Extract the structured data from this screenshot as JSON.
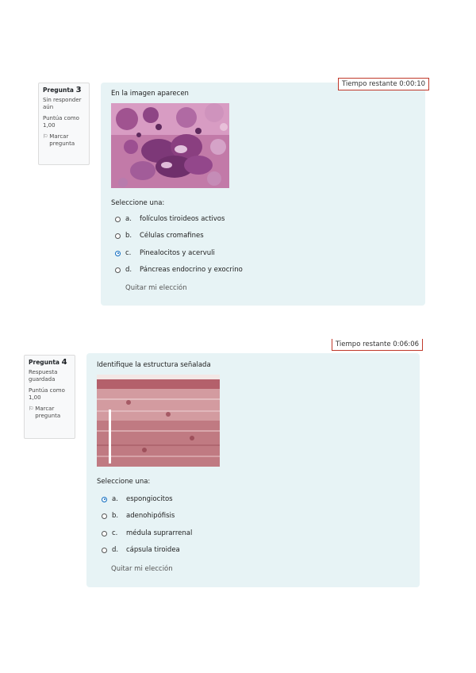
{
  "questions": [
    {
      "label": "Pregunta",
      "number": "3",
      "status": "Sin responder aún",
      "score": "Puntúa como 1,00",
      "flag_label": "Marcar pregunta",
      "timer": "Tiempo restante 0:00:10",
      "text": "En la imagen aparecen",
      "prompt": "Seleccione una:",
      "options": [
        {
          "letter": "a.",
          "text": "folículos tiroideos activos",
          "selected": false
        },
        {
          "letter": "b.",
          "text": "Células cromafines",
          "selected": false
        },
        {
          "letter": "c.",
          "text": "Pinealocitos y acervuli",
          "selected": true
        },
        {
          "letter": "d.",
          "text": "Páncreas endocrino y exocrino",
          "selected": false
        }
      ],
      "clear_label": "Quitar mi elección"
    },
    {
      "label": "Pregunta",
      "number": "4",
      "status": "Respuesta guardada",
      "score": "Puntúa como 1,00",
      "flag_label": "Marcar pregunta",
      "timer": "Tiempo restante 0:06:06",
      "text": "Identifique la estructura señalada",
      "prompt": "Seleccione una:",
      "options": [
        {
          "letter": "a.",
          "text": "espongiocitos",
          "selected": true
        },
        {
          "letter": "b.",
          "text": "adenohipófisis",
          "selected": false
        },
        {
          "letter": "c.",
          "text": "médula suprarrenal",
          "selected": false
        },
        {
          "letter": "d.",
          "text": "cápsula tiroidea",
          "selected": false
        }
      ],
      "clear_label": "Quitar mi elección"
    }
  ],
  "colors": {
    "panel_bg": "#e7f3f5",
    "timer_border": "#c0392b",
    "radio_selected": "#0f6cbf"
  }
}
